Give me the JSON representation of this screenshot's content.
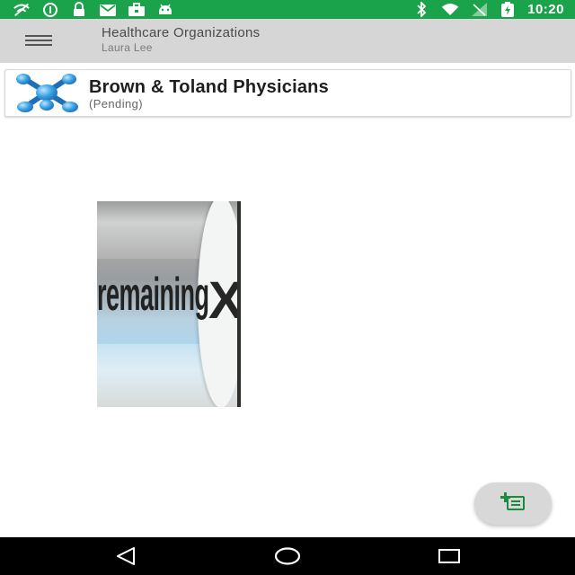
{
  "status_bar": {
    "time": "10:20",
    "left_icons": [
      "wifi-off-icon",
      "info-icon",
      "lock-icon",
      "mail-icon",
      "briefcase-icon",
      "android-icon"
    ],
    "right_icons": [
      "bluetooth-icon",
      "wifi-icon",
      "signal-icon",
      "battery-charging-icon"
    ]
  },
  "app_bar": {
    "title": "Healthcare Organizations",
    "subtitle": "Laura Lee",
    "menu_icon": "menu-icon"
  },
  "organization": {
    "name": "Brown & Toland Physicians",
    "status": "(Pending)",
    "logo_icon": "organization-logo-icon"
  },
  "ad": {
    "word": "remaining",
    "mark": "X"
  },
  "fab": {
    "icon": "add-organization-icon"
  },
  "nav_bar": {
    "icons": [
      "back-icon",
      "home-icon",
      "recents-icon"
    ]
  },
  "colors": {
    "status_bar": "#1aa34a",
    "app_bar": "#d6d6d6",
    "fab_icon": "#1e8a3e",
    "logo_blue": "#3aa3e6"
  }
}
